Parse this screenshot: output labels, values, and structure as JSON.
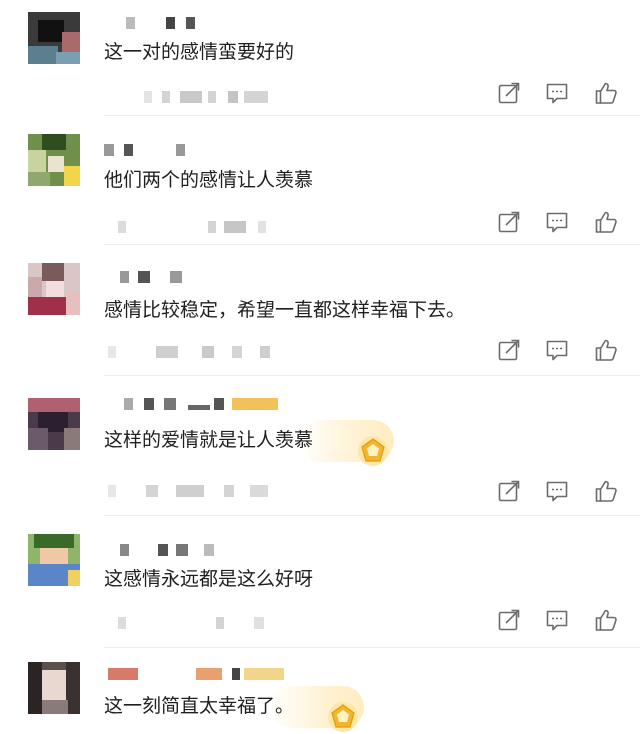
{
  "comments": [
    {
      "text": "这一对的感情蛮要好的"
    },
    {
      "text": "他们两个的感情让人羡慕"
    },
    {
      "text": "感情比较稳定，希望一直都这样幸福下去。"
    },
    {
      "text": "这样的爱情就是让人羡慕"
    },
    {
      "text": "这感情永远都是这么好呀"
    },
    {
      "text": "这一刻简直太幸福了。"
    }
  ],
  "actions": [
    "share-icon",
    "reply-icon",
    "like-icon"
  ],
  "colors": {
    "icon": "#6b6b6b",
    "divider": "#efefef",
    "badge_gold": "#f2b630",
    "badge_glow": "#fff0cd"
  }
}
